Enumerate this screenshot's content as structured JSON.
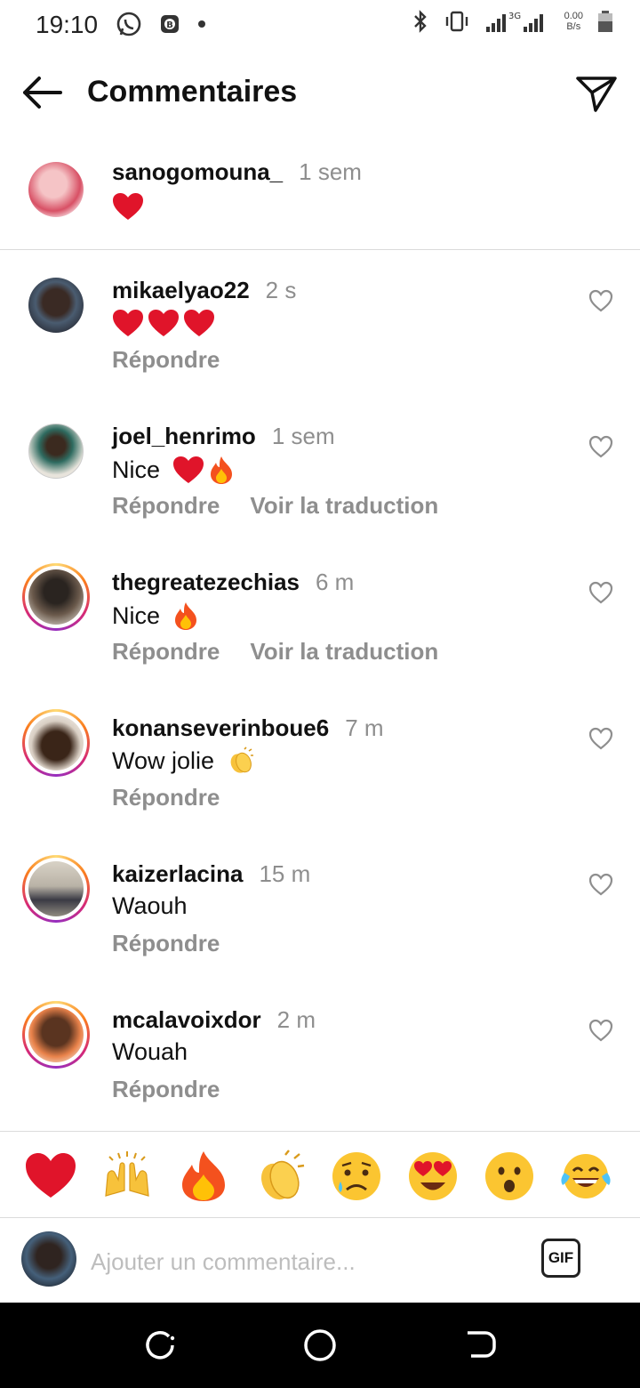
{
  "status_bar": {
    "time": "19:10",
    "network": "3G",
    "speed_value": "0.00",
    "speed_unit": "B/s"
  },
  "header": {
    "title": "Commentaires"
  },
  "caption": {
    "username": "sanogomouna_",
    "time": "1 sem",
    "text": ""
  },
  "comments": [
    {
      "username": "mikaelyao22",
      "time": "2 s",
      "text": "",
      "reply": "Répondre",
      "translate": ""
    },
    {
      "username": "joel_henrimo",
      "time": "1 sem",
      "text": "Nice",
      "reply": "Répondre",
      "translate": "Voir la traduction"
    },
    {
      "username": "thegreatezechias",
      "time": "6 m",
      "text": "Nice",
      "reply": "Répondre",
      "translate": "Voir la traduction"
    },
    {
      "username": "konanseverinboue6",
      "time": "7 m",
      "text": "Wow jolie",
      "reply": "Répondre",
      "translate": ""
    },
    {
      "username": "kaizerlacina",
      "time": "15 m",
      "text": "Waouh",
      "reply": "Répondre",
      "translate": ""
    },
    {
      "username": "mcalavoixdor",
      "time": "2 m",
      "text": "Wouah",
      "reply": "Répondre",
      "translate": ""
    }
  ],
  "emoji_bar": [
    "heart",
    "raising-hands",
    "fire",
    "clapping-hands",
    "sad-face",
    "heart-eyes-face",
    "surprised-face",
    "tears-of-joy-face"
  ],
  "composer": {
    "placeholder": "Ajouter un commentaire...",
    "gif_label": "GIF"
  },
  "colors": {
    "text": "#111111",
    "muted": "#8e8e8e",
    "divider": "#dbdbdb",
    "heart": "#e0142a"
  }
}
